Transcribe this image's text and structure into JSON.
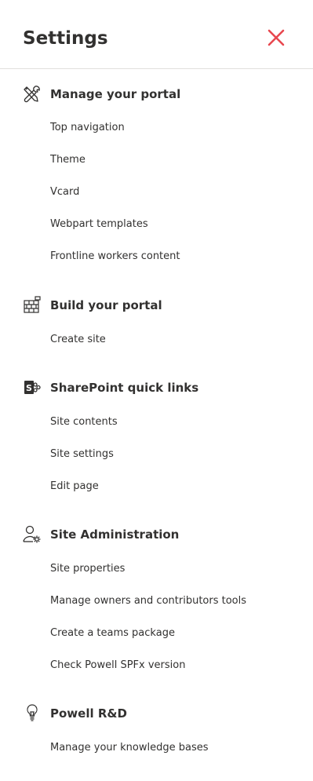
{
  "header": {
    "title": "Settings"
  },
  "sections": [
    {
      "icon": "tools-icon",
      "title": "Manage your portal",
      "items": [
        "Top navigation",
        "Theme",
        "Vcard",
        "Webpart templates",
        "Frontline workers content"
      ]
    },
    {
      "icon": "brick-wall-icon",
      "title": "Build your portal",
      "items": [
        "Create site"
      ]
    },
    {
      "icon": "sharepoint-icon",
      "title": "SharePoint quick links",
      "items": [
        "Site contents",
        "Site settings",
        "Edit page"
      ]
    },
    {
      "icon": "user-gear-icon",
      "title": "Site Administration",
      "items": [
        "Site properties",
        "Manage owners and contributors tools",
        "Create a teams package",
        "Check Powell SPFx version"
      ]
    },
    {
      "icon": "lightbulb-icon",
      "title": "Powell R&D",
      "items": [
        "Manage your knowledge bases"
      ]
    }
  ],
  "colors": {
    "close": "#e8474f",
    "text": "#323130",
    "divider": "#e1dfdd"
  }
}
